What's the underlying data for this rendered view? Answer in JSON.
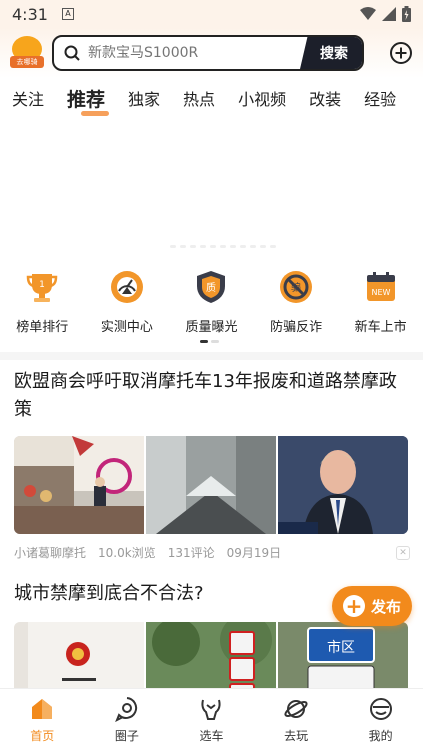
{
  "status_bar": {
    "time": "4:31",
    "notification_letter": "A"
  },
  "header": {
    "logo_text": "去哪骑",
    "search_placeholder": "新款宝马S1000R",
    "search_button": "搜索"
  },
  "tabs": [
    {
      "label": "关注",
      "active": false
    },
    {
      "label": "推荐",
      "active": true
    },
    {
      "label": "独家",
      "active": false
    },
    {
      "label": "热点",
      "active": false
    },
    {
      "label": "小视频",
      "active": false
    },
    {
      "label": "改装",
      "active": false
    },
    {
      "label": "经验",
      "active": false
    }
  ],
  "quick_nav": [
    {
      "label": "榜单排行",
      "icon": "trophy-icon",
      "badge": "1"
    },
    {
      "label": "实测中心",
      "icon": "gauge-icon",
      "badge": ""
    },
    {
      "label": "质量曝光",
      "icon": "shield-quality-icon",
      "badge": "质"
    },
    {
      "label": "防骗反诈",
      "icon": "anti-fraud-icon",
      "badge": "骗"
    },
    {
      "label": "新车上市",
      "icon": "calendar-new-icon",
      "badge": "NEW"
    }
  ],
  "articles": [
    {
      "title": "欧盟商会呼吁取消摩托车13年报废和道路禁摩政策",
      "author": "小诸葛聊摩托",
      "views": "10.0k浏览",
      "comments": "131评论",
      "date": "09月19日"
    },
    {
      "title": "城市禁摩到底合不合法?",
      "sign_text": "市区"
    }
  ],
  "publish_button": {
    "label": "发布"
  },
  "bottom_nav": [
    {
      "label": "首页",
      "icon": "home-icon",
      "active": true
    },
    {
      "label": "圈子",
      "icon": "circle-icon",
      "active": false
    },
    {
      "label": "选车",
      "icon": "motorcycle-icon",
      "active": false
    },
    {
      "label": "去玩",
      "icon": "planet-icon",
      "active": false
    },
    {
      "label": "我的",
      "icon": "profile-icon",
      "active": false
    }
  ],
  "colors": {
    "accent": "#f28a1c",
    "dark": "#1c1f2a",
    "tab_underline": "#f6a05b"
  }
}
